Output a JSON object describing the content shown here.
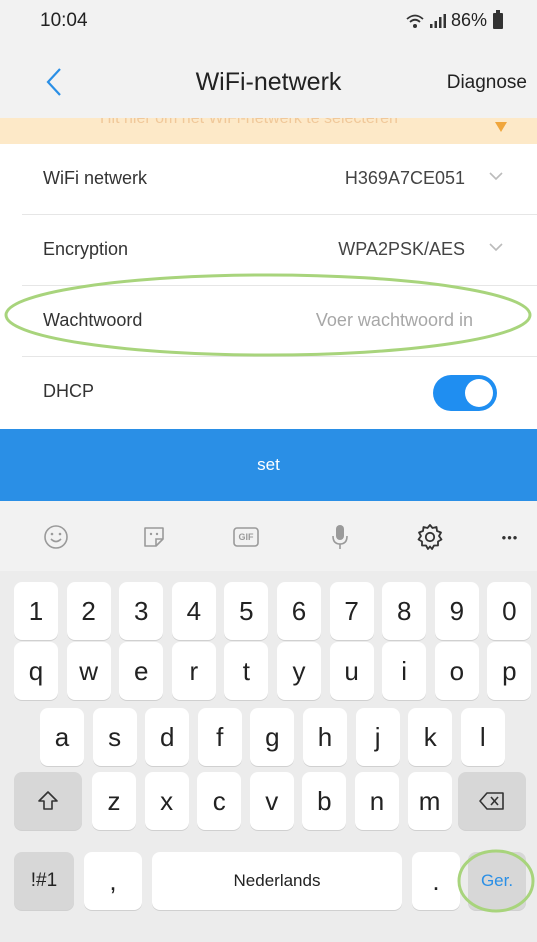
{
  "status": {
    "time": "10:04",
    "battery": "86%"
  },
  "nav": {
    "title": "WiFi-netwerk",
    "diagnose": "Diagnose"
  },
  "banner": {
    "text": "Hit hier om het WiFi-netwerk te selecteren"
  },
  "form": {
    "wifi": {
      "label": "WiFi netwerk",
      "value": "H369A7CE051"
    },
    "encryption": {
      "label": "Encryption",
      "value": "WPA2PSK/AES"
    },
    "password": {
      "label": "Wachtwoord",
      "placeholder": "Voer wachtwoord in"
    },
    "dhcp": {
      "label": "DHCP",
      "on": true
    }
  },
  "set_button": {
    "label": "set"
  },
  "keyboard": {
    "toolbar": {
      "gif": "GIF",
      "more": "•••"
    },
    "numbers": [
      "1",
      "2",
      "3",
      "4",
      "5",
      "6",
      "7",
      "8",
      "9",
      "0"
    ],
    "row1": [
      "q",
      "w",
      "e",
      "r",
      "t",
      "y",
      "u",
      "i",
      "o",
      "p"
    ],
    "row2": [
      "a",
      "s",
      "d",
      "f",
      "g",
      "h",
      "j",
      "k",
      "l"
    ],
    "row3": [
      "z",
      "x",
      "c",
      "v",
      "b",
      "n",
      "m"
    ],
    "symbols": "!#1",
    "comma": ",",
    "space": "Nederlands",
    "period": ".",
    "enter": "Ger."
  },
  "colors": {
    "accent": "#2a8fe6",
    "highlight": "#a8d47c",
    "banner": "#fde9c8"
  }
}
